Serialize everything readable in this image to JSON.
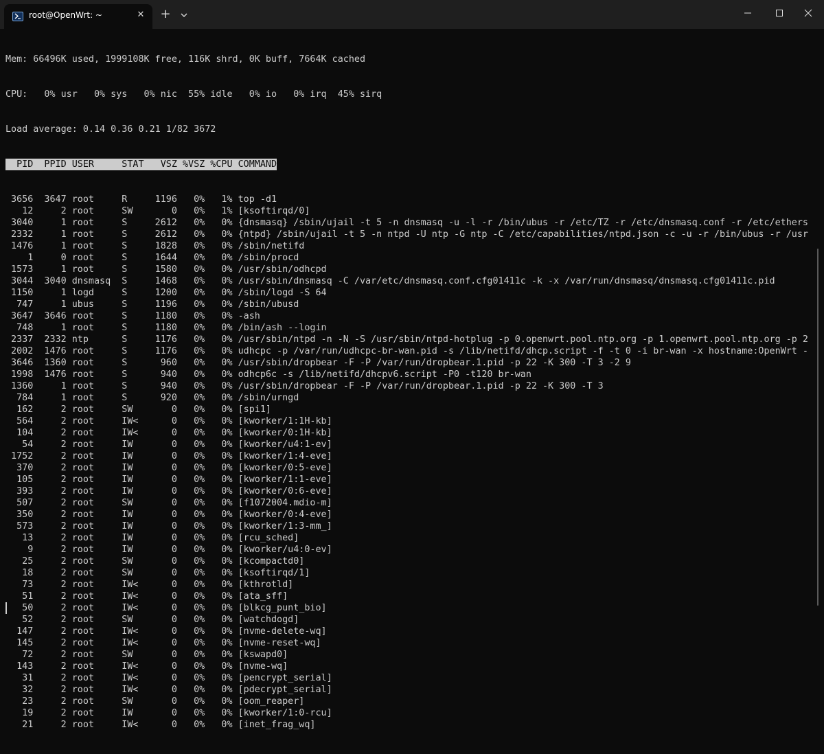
{
  "window": {
    "tab_title": "root@OpenWrt: ~",
    "tab_close": "✕",
    "new_tab": "+",
    "icons": {
      "tab": "powershell-icon",
      "dropdown": "chevron-down-icon",
      "minimize": "minimize-icon",
      "maximize": "maximize-icon",
      "close": "close-icon"
    }
  },
  "terminal": {
    "mem_line": "Mem: 66496K used, 1999108K free, 116K shrd, 0K buff, 7664K cached",
    "cpu_line": "CPU:   0% usr   0% sys   0% nic  55% idle   0% io   0% irq  45% sirq",
    "load_line": "Load average: 0.14 0.36 0.21 1/82 3672",
    "header_line": "  PID  PPID USER     STAT   VSZ %VSZ %CPU COMMAND",
    "processes": [
      " 3656  3647 root     R     1196   0%   1% top -d1",
      "   12     2 root     SW       0   0%   1% [ksoftirqd/0]",
      " 3040     1 root     S     2612   0%   0% {dnsmasq} /sbin/ujail -t 5 -n dnsmasq -u -l -r /bin/ubus -r /etc/TZ -r /etc/dnsmasq.conf -r /etc/ethers",
      " 2332     1 root     S     2612   0%   0% {ntpd} /sbin/ujail -t 5 -n ntpd -U ntp -G ntp -C /etc/capabilities/ntpd.json -c -u -r /bin/ubus -r /usr",
      " 1476     1 root     S     1828   0%   0% /sbin/netifd",
      "    1     0 root     S     1644   0%   0% /sbin/procd",
      " 1573     1 root     S     1580   0%   0% /usr/sbin/odhcpd",
      " 3044  3040 dnsmasq  S     1468   0%   0% /usr/sbin/dnsmasq -C /var/etc/dnsmasq.conf.cfg01411c -k -x /var/run/dnsmasq/dnsmasq.cfg01411c.pid",
      " 1150     1 logd     S     1200   0%   0% /sbin/logd -S 64",
      "  747     1 ubus     S     1196   0%   0% /sbin/ubusd",
      " 3647  3646 root     S     1180   0%   0% -ash",
      "  748     1 root     S     1180   0%   0% /bin/ash --login",
      " 2337  2332 ntp      S     1176   0%   0% /usr/sbin/ntpd -n -N -S /usr/sbin/ntpd-hotplug -p 0.openwrt.pool.ntp.org -p 1.openwrt.pool.ntp.org -p 2",
      " 2002  1476 root     S     1176   0%   0% udhcpc -p /var/run/udhcpc-br-wan.pid -s /lib/netifd/dhcp.script -f -t 0 -i br-wan -x hostname:OpenWrt -",
      " 3646  1360 root     S      960   0%   0% /usr/sbin/dropbear -F -P /var/run/dropbear.1.pid -p 22 -K 300 -T 3 -2 9",
      " 1998  1476 root     S      940   0%   0% odhcp6c -s /lib/netifd/dhcpv6.script -P0 -t120 br-wan",
      " 1360     1 root     S      940   0%   0% /usr/sbin/dropbear -F -P /var/run/dropbear.1.pid -p 22 -K 300 -T 3",
      "  784     1 root     S      920   0%   0% /sbin/urngd",
      "  162     2 root     SW       0   0%   0% [spi1]",
      "  564     2 root     IW<      0   0%   0% [kworker/1:1H-kb]",
      "  104     2 root     IW<      0   0%   0% [kworker/0:1H-kb]",
      "   54     2 root     IW       0   0%   0% [kworker/u4:1-ev]",
      " 1752     2 root     IW       0   0%   0% [kworker/1:4-eve]",
      "  370     2 root     IW       0   0%   0% [kworker/0:5-eve]",
      "  105     2 root     IW       0   0%   0% [kworker/1:1-eve]",
      "  393     2 root     IW       0   0%   0% [kworker/0:6-eve]",
      "  507     2 root     SW       0   0%   0% [f1072004.mdio-m]",
      "  350     2 root     IW       0   0%   0% [kworker/0:4-eve]",
      "  573     2 root     IW       0   0%   0% [kworker/1:3-mm_]",
      "   13     2 root     IW       0   0%   0% [rcu_sched]",
      "    9     2 root     IW       0   0%   0% [kworker/u4:0-ev]",
      "   25     2 root     SW       0   0%   0% [kcompactd0]",
      "   18     2 root     SW       0   0%   0% [ksoftirqd/1]",
      "   73     2 root     IW<      0   0%   0% [kthrotld]",
      "   51     2 root     IW<      0   0%   0% [ata_sff]",
      "   50     2 root     IW<      0   0%   0% [blkcg_punt_bio]",
      "   52     2 root     SW       0   0%   0% [watchdogd]",
      "  147     2 root     IW<      0   0%   0% [nvme-delete-wq]",
      "  145     2 root     IW<      0   0%   0% [nvme-reset-wq]",
      "   72     2 root     SW       0   0%   0% [kswapd0]",
      "  143     2 root     IW<      0   0%   0% [nvme-wq]",
      "   31     2 root     IW<      0   0%   0% [pencrypt_serial]",
      "   32     2 root     IW<      0   0%   0% [pdecrypt_serial]",
      "   23     2 root     SW       0   0%   0% [oom_reaper]",
      "   19     2 root     IW       0   0%   0% [kworker/1:0-rcu]",
      "   21     2 root     IW<      0   0%   0% [inet_frag_wq]"
    ]
  }
}
